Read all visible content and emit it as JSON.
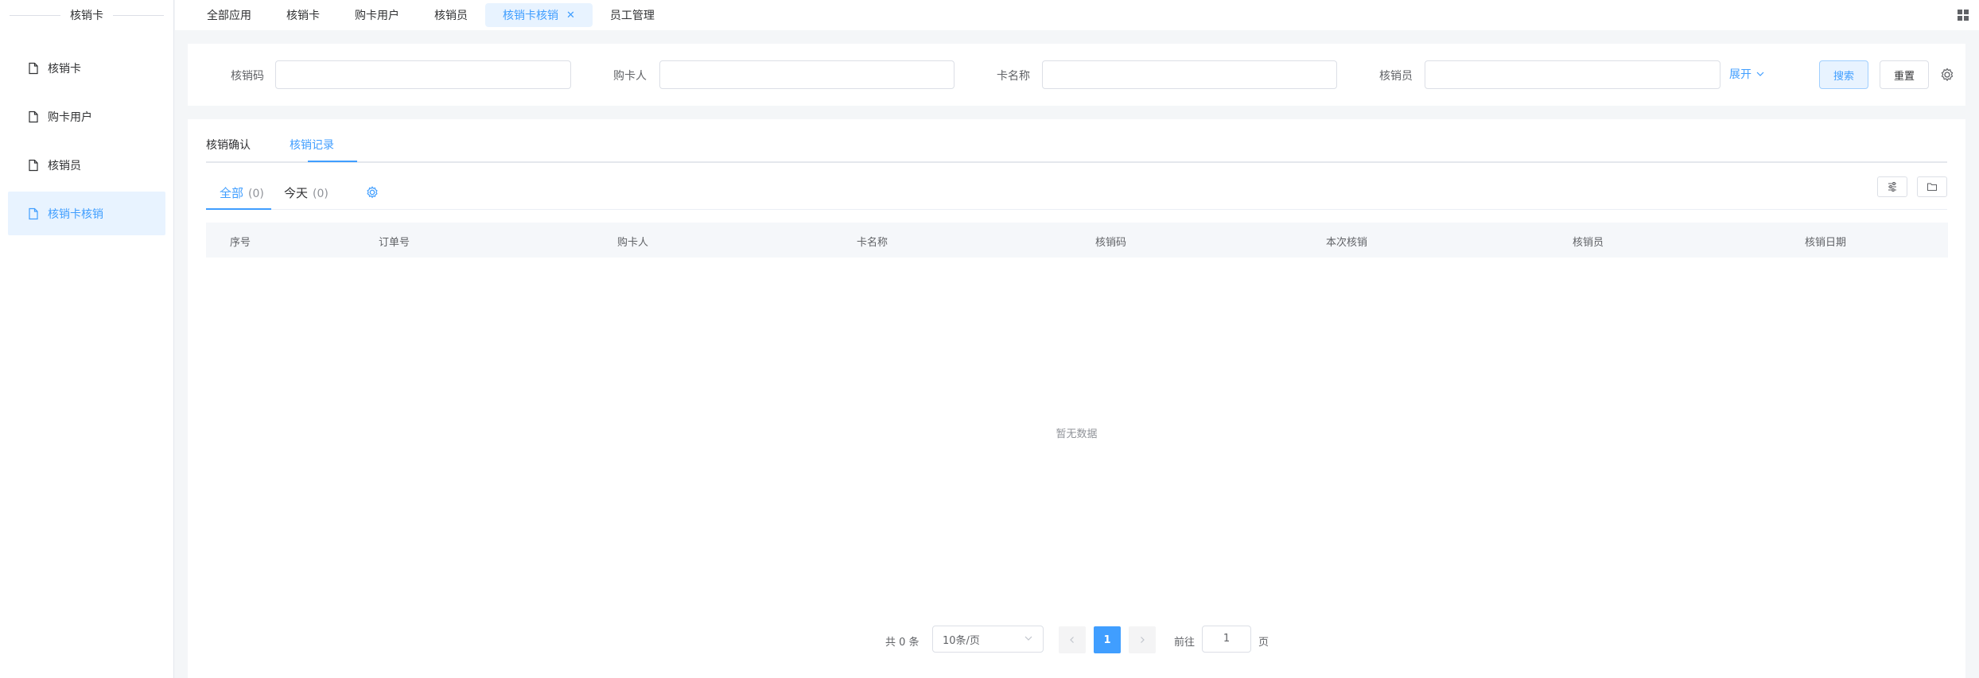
{
  "sidebar": {
    "title": "核销卡",
    "items": [
      {
        "label": "核销卡"
      },
      {
        "label": "购卡用户"
      },
      {
        "label": "核销员"
      },
      {
        "label": "核销卡核销"
      }
    ]
  },
  "topbar": {
    "tabs": [
      {
        "label": "全部应用"
      },
      {
        "label": "核销卡"
      },
      {
        "label": "购卡用户"
      },
      {
        "label": "核销员"
      },
      {
        "label": "核销卡核销"
      },
      {
        "label": "员工管理"
      }
    ],
    "active_index": 4
  },
  "search": {
    "fields": [
      {
        "label": "核销码",
        "value": ""
      },
      {
        "label": "购卡人",
        "value": ""
      },
      {
        "label": "卡名称",
        "value": ""
      },
      {
        "label": "核销员",
        "value": ""
      }
    ],
    "expand_label": "展开",
    "search_label": "搜索",
    "reset_label": "重置"
  },
  "main": {
    "tabs": [
      {
        "label": "核销确认"
      },
      {
        "label": "核销记录"
      }
    ],
    "active_tab": 1,
    "sub_tabs": [
      {
        "label": "全部",
        "count": "(0)"
      },
      {
        "label": "今天",
        "count": "(0)"
      }
    ],
    "columns": [
      "序号",
      "订单号",
      "购卡人",
      "卡名称",
      "核销码",
      "本次核销",
      "核销员",
      "核销日期"
    ],
    "rows": [],
    "empty_text": "暂无数据"
  },
  "pagination": {
    "total_text": "共 0 条",
    "page_size": "10条/页",
    "current_page": "1",
    "goto_label": "前往",
    "goto_value": "1",
    "page_suffix": "页"
  },
  "colors": {
    "accent": "#409eff",
    "active_bg": "#e8f3ff"
  }
}
